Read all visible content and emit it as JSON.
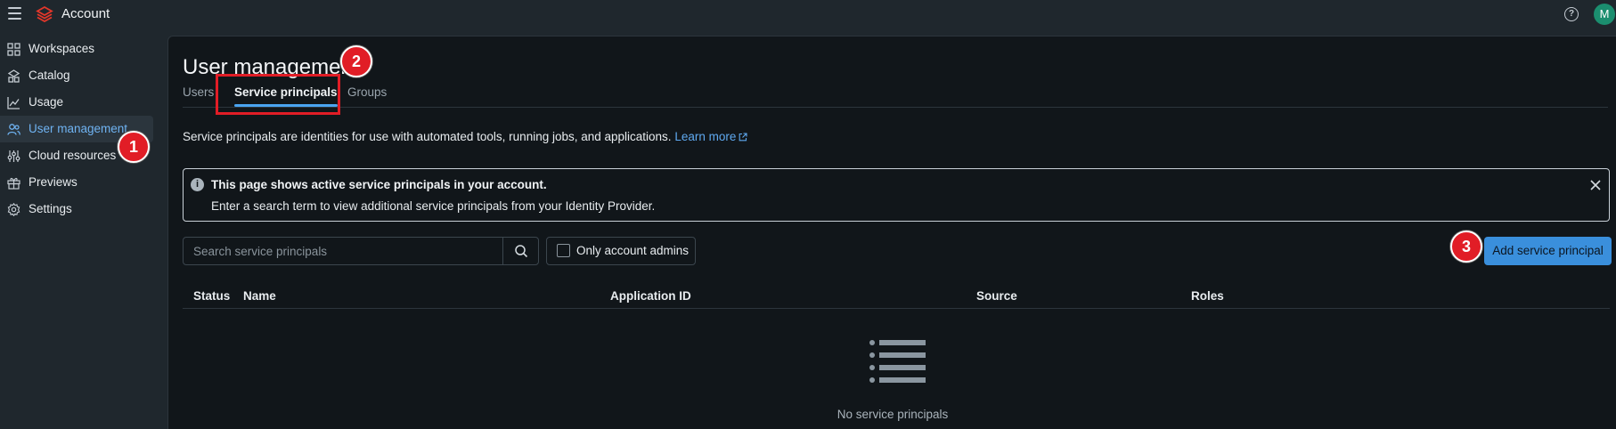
{
  "app": {
    "title": "Account",
    "help_glyph": "?",
    "avatar_initial": "M",
    "brand_color": "#e5372a",
    "accent_color": "#4aa4f0"
  },
  "sidebar": {
    "items": [
      {
        "label": "Workspaces",
        "icon": "workspaces-icon"
      },
      {
        "label": "Catalog",
        "icon": "catalog-icon"
      },
      {
        "label": "Usage",
        "icon": "usage-icon"
      },
      {
        "label": "User management",
        "icon": "users-icon",
        "active": true
      },
      {
        "label": "Cloud resources",
        "icon": "cloud-resources-icon"
      },
      {
        "label": "Previews",
        "icon": "previews-icon"
      },
      {
        "label": "Settings",
        "icon": "gear-icon"
      }
    ]
  },
  "main": {
    "title": "User management",
    "tabs": [
      {
        "label": "Users"
      },
      {
        "label": "Service principals",
        "active": true
      },
      {
        "label": "Groups"
      }
    ],
    "description": "Service principals are identities for use with automated tools, running jobs, and applications.",
    "learn_more": "Learn more",
    "banner": {
      "title": "This page shows active service principals in your account.",
      "text": "Enter a search term to view additional service principals from your Identity Provider."
    },
    "search": {
      "placeholder": "Search service principals",
      "value": ""
    },
    "filter_label": "Only account admins",
    "add_button": "Add service principal",
    "columns": [
      "Status",
      "Name",
      "Application ID",
      "Source",
      "Roles"
    ],
    "rows": [],
    "empty_text": "No service principals"
  },
  "annotations": {
    "markers": [
      "1",
      "2",
      "3"
    ],
    "color": "#e11d26"
  }
}
